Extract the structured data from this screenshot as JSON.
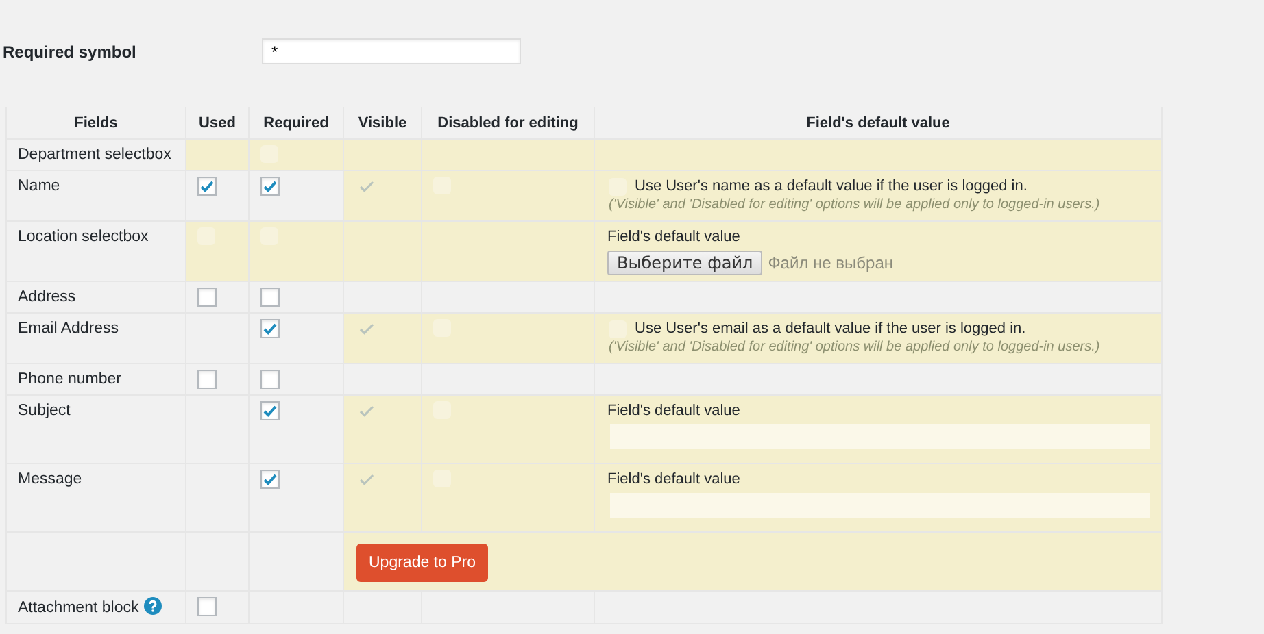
{
  "required_symbol": {
    "label": "Required symbol",
    "value": "*"
  },
  "table": {
    "columns": [
      "Fields",
      "Used",
      "Required",
      "Visible",
      "Disabled for editing",
      "Field's default value"
    ],
    "rows": [
      {
        "kind": "field",
        "label": "Department selectbox",
        "help": false,
        "used": {
          "locked": true
        },
        "required": {
          "locked": true,
          "checked": false
        },
        "visible": {
          "locked": true
        },
        "disabled": {
          "locked": true
        },
        "default": {
          "locked": true,
          "kind": "empty"
        }
      },
      {
        "kind": "field",
        "label": "Name",
        "help": false,
        "used": {
          "locked": false,
          "checked": true
        },
        "required": {
          "locked": false,
          "checked": true
        },
        "visible": {
          "locked": true,
          "checked": true
        },
        "disabled": {
          "locked": true,
          "checked": false
        },
        "default": {
          "locked": true,
          "kind": "user_option",
          "checked": false,
          "option": "Use User's name as a default value if the user is logged in.",
          "note": "('Visible' and 'Disabled for editing' options will be applied only to logged-in users.)"
        }
      },
      {
        "kind": "field",
        "label": "Location selectbox",
        "help": false,
        "used": {
          "locked": true,
          "checked": false
        },
        "required": {
          "locked": true,
          "checked": false
        },
        "visible": {
          "locked": true
        },
        "disabled": {
          "locked": true
        },
        "default": {
          "locked": true,
          "kind": "file",
          "label": "Field's default value",
          "button": "Выберите файл",
          "status": "Файл не выбран"
        }
      },
      {
        "kind": "field",
        "label": "Address",
        "help": false,
        "used": {
          "locked": false,
          "checked": false
        },
        "required": {
          "locked": false,
          "checked": false
        },
        "visible": {
          "locked": false
        },
        "disabled": {
          "locked": false
        },
        "default": {
          "locked": false,
          "kind": "empty"
        }
      },
      {
        "kind": "field",
        "label": "Email Address",
        "help": false,
        "used": {
          "locked": false
        },
        "required": {
          "locked": false,
          "checked": true
        },
        "visible": {
          "locked": true,
          "checked": true
        },
        "disabled": {
          "locked": true,
          "checked": false
        },
        "default": {
          "locked": true,
          "kind": "user_option",
          "checked": false,
          "option": "Use User's email as a default value if the user is logged in.",
          "note": "('Visible' and 'Disabled for editing' options will be applied only to logged-in users.)"
        }
      },
      {
        "kind": "field",
        "label": "Phone number",
        "help": false,
        "used": {
          "locked": false,
          "checked": false
        },
        "required": {
          "locked": false,
          "checked": false
        },
        "visible": {
          "locked": false
        },
        "disabled": {
          "locked": false
        },
        "default": {
          "locked": false,
          "kind": "empty"
        }
      },
      {
        "kind": "field",
        "label": "Subject",
        "help": false,
        "used": {
          "locked": false
        },
        "required": {
          "locked": false,
          "checked": true
        },
        "visible": {
          "locked": true,
          "checked": true
        },
        "disabled": {
          "locked": true,
          "checked": false
        },
        "default": {
          "locked": true,
          "kind": "text",
          "label": "Field's default value"
        }
      },
      {
        "kind": "field",
        "label": "Message",
        "help": false,
        "used": {
          "locked": false
        },
        "required": {
          "locked": false,
          "checked": true
        },
        "visible": {
          "locked": true,
          "checked": true
        },
        "disabled": {
          "locked": true,
          "checked": false
        },
        "default": {
          "locked": true,
          "kind": "text",
          "label": "Field's default value"
        }
      },
      {
        "kind": "upgrade",
        "button": "Upgrade to Pro"
      },
      {
        "kind": "field",
        "label": "Attachment block",
        "help": true,
        "used": {
          "locked": false,
          "checked": false
        },
        "required": {
          "locked": false
        },
        "visible": {
          "locked": false
        },
        "disabled": {
          "locked": false
        },
        "default": {
          "locked": false,
          "kind": "empty"
        }
      }
    ]
  }
}
